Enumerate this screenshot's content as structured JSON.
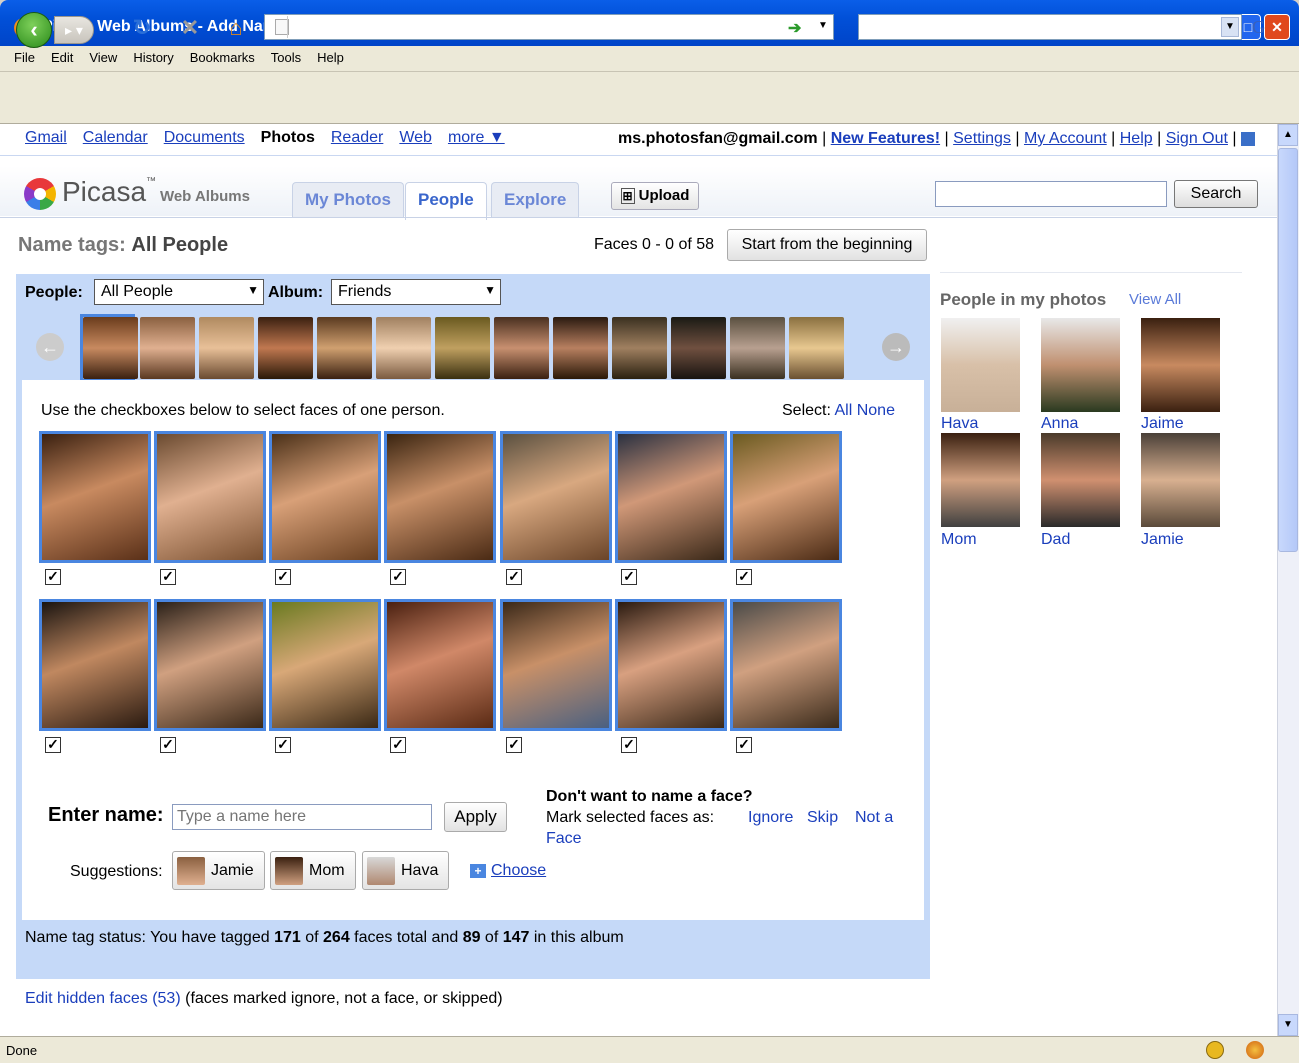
{
  "window": {
    "title": "Picasa Web Albums - Add Name Tags - Mozilla Firefox"
  },
  "menu": [
    "File",
    "Edit",
    "View",
    "History",
    "Bookmarks",
    "Tools",
    "Help"
  ],
  "gbar": {
    "links": [
      "Gmail",
      "Calendar",
      "Documents",
      "Photos",
      "Reader",
      "Web",
      "more ▼"
    ],
    "email": "ms.photosfan@gmail.com",
    "right_links": [
      "New Features!",
      "Settings",
      "My Account",
      "Help",
      "Sign Out"
    ]
  },
  "header": {
    "logo": "Picasa",
    "logo_sub": "Web Albums",
    "tabs": [
      "My Photos",
      "People",
      "Explore"
    ],
    "upload": "Upload",
    "search_btn": "Search"
  },
  "nametags": {
    "title_prefix": "Name tags:",
    "title_value": "All People",
    "faces_count": "Faces 0 - 0 of 58",
    "start_btn": "Start from the beginning",
    "people_label": "People:",
    "people_value": "All People",
    "album_label": "Album:",
    "album_value": "Friends",
    "instruction": "Use the checkboxes below to select faces of one person.",
    "select_label": "Select:",
    "select_all": "All",
    "select_none": "None",
    "enter_name_label": "Enter name:",
    "name_placeholder": "Type a name here",
    "apply_btn": "Apply",
    "dont_want": "Don't want to name a face?",
    "mark_as": "Mark selected faces as:",
    "ignore": "Ignore",
    "skip": "Skip",
    "not_a": "Not a",
    "face": "Face",
    "suggestions_label": "Suggestions:",
    "suggestions": [
      "Jamie",
      "Mom",
      "Hava"
    ],
    "choose": "Choose",
    "status_text_1": "Name tag status: You have tagged ",
    "status_tagged": "171",
    "status_text_2": " of ",
    "status_total": "264",
    "status_text_3": " faces total and ",
    "status_album_tagged": "89",
    "status_text_4": " of ",
    "status_album_total": "147",
    "status_text_5": " in this album",
    "hidden_link": "Edit hidden faces (53)",
    "hidden_note": "(faces marked ignore, not a face, or skipped)"
  },
  "people_panel": {
    "title": "People in my photos",
    "view_all": "View All",
    "people": [
      "Hava",
      "Anna",
      "Jaime",
      "Mom",
      "Dad",
      "Jamie"
    ]
  },
  "statusbar": {
    "text": "Done"
  },
  "colors": {
    "panel_blue": "#c5d9f8",
    "link_blue": "#1a3ebc",
    "face_border": "#4a86e0"
  }
}
